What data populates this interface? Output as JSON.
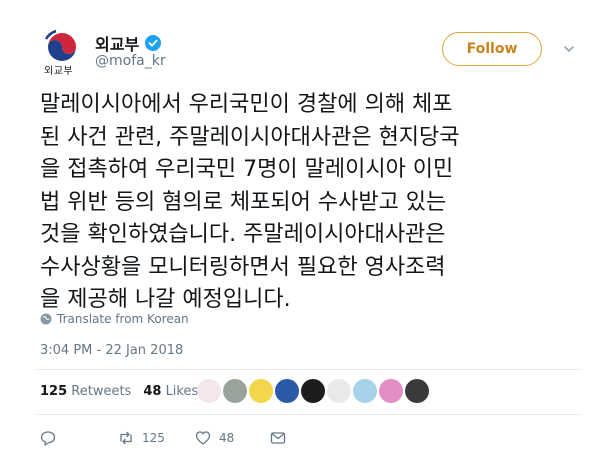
{
  "header": {
    "display_name": "외교부",
    "handle": "@mofa_kr",
    "avatar_caption": "외교부",
    "follow_label": "Follow"
  },
  "tweet": {
    "text": "말레이시아에서 우리국민이 경찰에 의해 체포\n된 사건 관련, 주말레이시아대사관은 현지당국\n을 접촉하여 우리국민 7명이 말레이시아 이민\n법 위반 등의 혐의로 체포되어 수사받고 있는\n것을 확인하였습니다. 주말레이시아대사관은\n수사상황을 모니터링하면서 필요한 영사조력\n을 제공해 나갈 예정입니다.",
    "translate_label": "Translate from Korean",
    "timestamp": "3:04 PM - 22 Jan 2018"
  },
  "stats": {
    "retweets_count": "125",
    "retweets_label": "Retweets",
    "likes_count": "48",
    "likes_label": "Likes"
  },
  "actions": {
    "reply_count": "",
    "retweet_count": "125",
    "like_count": "48"
  },
  "colors": {
    "accent": "#c88419",
    "muted": "#657786",
    "text": "#14171a",
    "verified": "#1da1f2"
  }
}
